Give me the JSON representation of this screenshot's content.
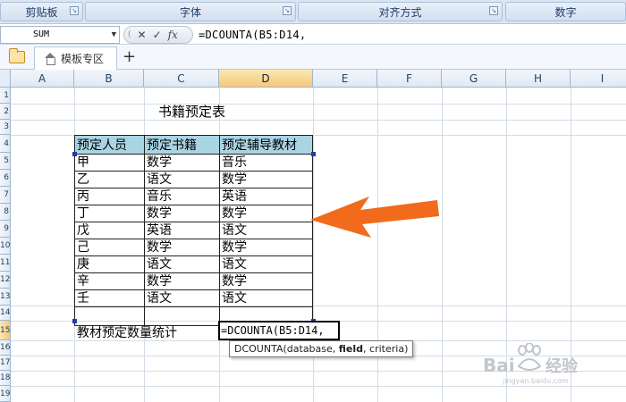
{
  "ribbon": {
    "groups": [
      "剪贴板",
      "字体",
      "对齐方式",
      "数字"
    ]
  },
  "formula_bar": {
    "name_box": "SUM",
    "formula": "=DCOUNTA(B5:D14,"
  },
  "tabs": {
    "active": "模板专区"
  },
  "columns": [
    "A",
    "B",
    "C",
    "D",
    "E",
    "F",
    "G",
    "H",
    "I"
  ],
  "rows": [
    "1",
    "2",
    "3",
    "4",
    "5",
    "6",
    "7",
    "8",
    "9",
    "10",
    "11",
    "12",
    "13",
    "14",
    "15",
    "16",
    "17",
    "18",
    "19"
  ],
  "sheet": {
    "title": "书籍预定表",
    "headers": [
      "预定人员",
      "预定书籍",
      "预定辅导教材"
    ],
    "records": [
      [
        "甲",
        "数学",
        "音乐"
      ],
      [
        "乙",
        "语文",
        "数学"
      ],
      [
        "丙",
        "音乐",
        "英语"
      ],
      [
        "丁",
        "数学",
        "数学"
      ],
      [
        "戊",
        "英语",
        "语文"
      ],
      [
        "己",
        "数学",
        "数学"
      ],
      [
        "庚",
        "语文",
        "语文"
      ],
      [
        "辛",
        "数学",
        "数学"
      ],
      [
        "壬",
        "语文",
        "语文"
      ]
    ],
    "stat_label": "教材预定数量统计",
    "edit_value": "=DCOUNTA(B5:D14,",
    "tooltip": {
      "fn": "DCOUNTA(",
      "arg1": "database, ",
      "arg2": "field",
      "arg3": ", criteria)"
    }
  },
  "colors": {
    "header_fill": "#a9d4e3",
    "arrow": "#f26a1b",
    "selected_header": "#f6c77a"
  },
  "watermark": {
    "text": "Bai 经验",
    "subtext": "jingyan.baidu.com"
  },
  "icons": [
    "folder-icon",
    "home-icon",
    "add-tab-icon",
    "cancel-icon",
    "enter-icon",
    "fx-icon",
    "dropdown-icon",
    "arrow-annotation"
  ]
}
